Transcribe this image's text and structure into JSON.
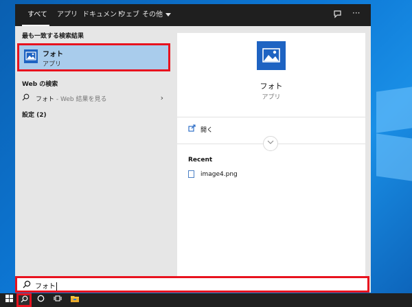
{
  "taskbar": {
    "start_icon": "windows-logo-icon",
    "search_icon": "search-icon",
    "cortana_icon": "circle-icon",
    "taskview_icon": "task-view-icon",
    "explorer_icon": "folder-icon"
  },
  "tabs": {
    "all": "すべて",
    "apps": "アプリ",
    "documents": "ドキュメント",
    "web": "ウェブ",
    "more": "その他"
  },
  "left": {
    "best_match_heading": "最も一致する検索結果",
    "best_match_title": "フォト",
    "best_match_sub": "アプリ",
    "web_heading": "Web の検索",
    "web_query": "フォト",
    "web_hint": " - Web 結果を見る",
    "settings_heading": "設定 (2)"
  },
  "right": {
    "app_title": "フォト",
    "app_sub": "アプリ",
    "open_label": "開く",
    "recent_heading": "Recent",
    "recent_file": "image4.png"
  },
  "search": {
    "value": "フォト"
  },
  "colors": {
    "accent": "#1e63c2",
    "highlight": "#a9ccec",
    "annotation": "#e8121e",
    "topbar": "#1f1f1f"
  }
}
